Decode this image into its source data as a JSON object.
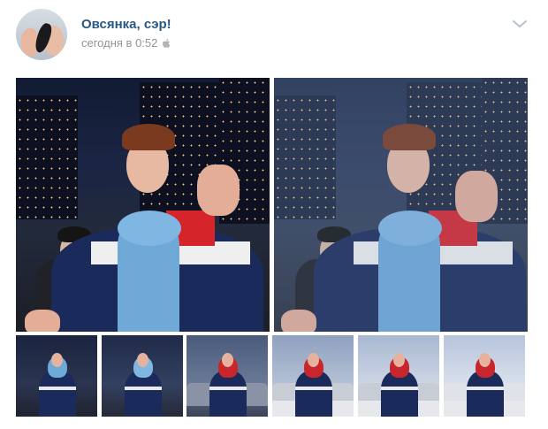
{
  "post": {
    "author": "Овсянка, сэр!",
    "time": "сегодня в 0:52",
    "platform_icon": "apple-icon",
    "menu_icon": "chevron-down-icon"
  },
  "photos": {
    "large_count": 2,
    "thumb_count": 6
  },
  "colors": {
    "author_link": "#2a5885",
    "meta_text": "#939393",
    "jacket_navy": "#1a2a5a",
    "jacket_red": "#d5252b",
    "hoodie_blue": "#6ea9d8"
  }
}
